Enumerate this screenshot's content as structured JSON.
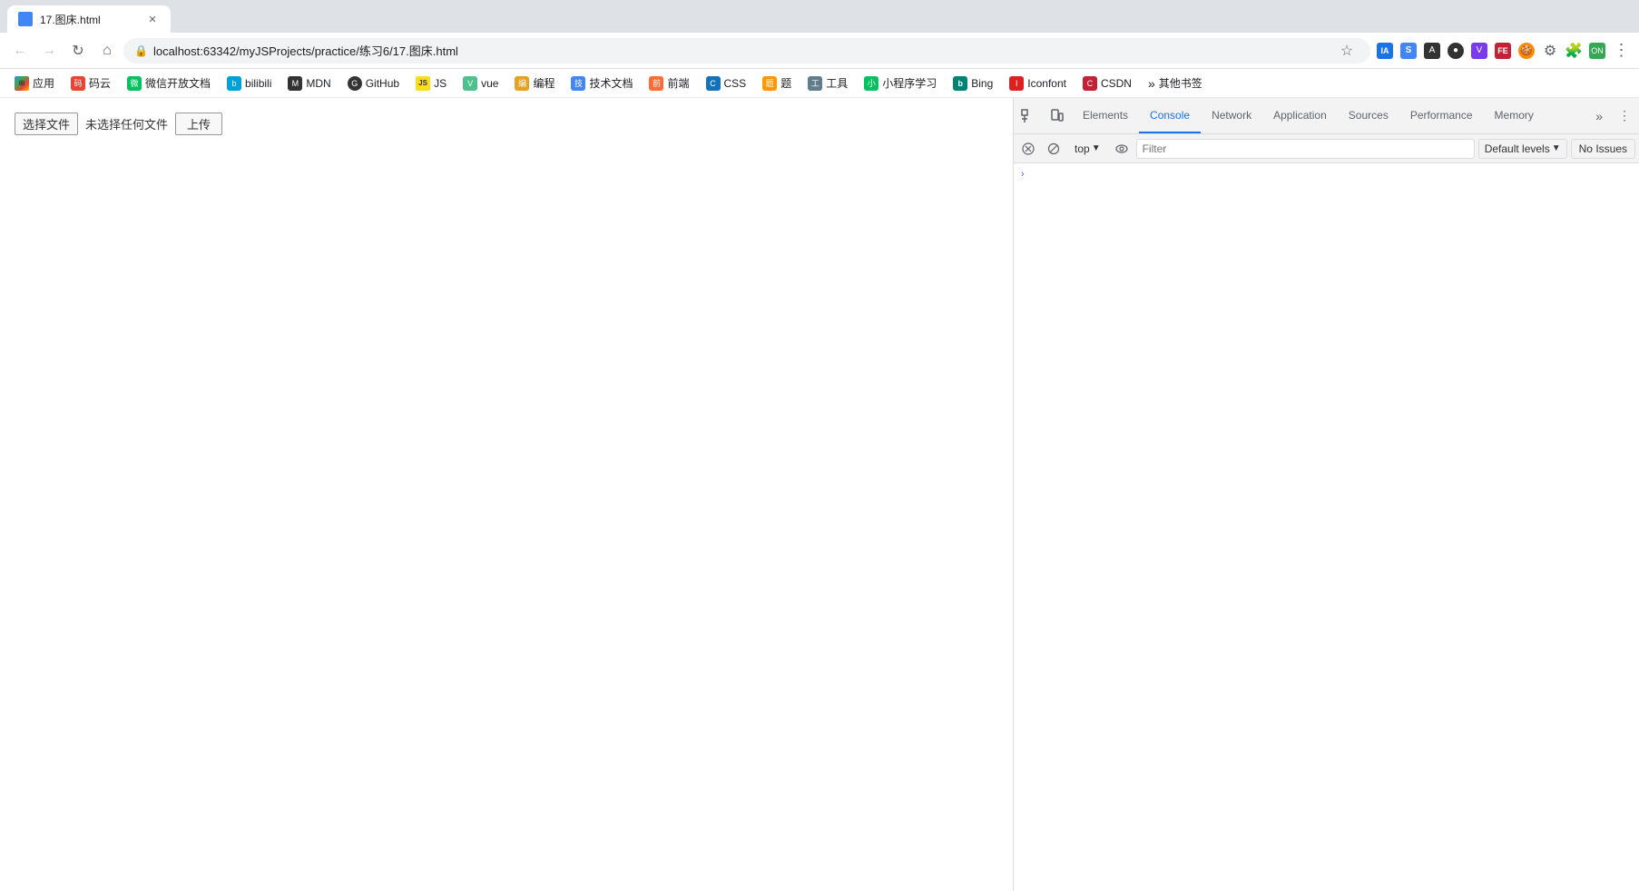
{
  "browser": {
    "tab": {
      "title": "17.图床.html",
      "favicon_color": "#4285f4"
    },
    "address": "localhost:63342/myJSProjects/practice/练习6/17.图床.html",
    "buttons": {
      "back": "‹",
      "forward": "›",
      "reload": "↻",
      "home": "⌂"
    }
  },
  "bookmarks": [
    {
      "label": "应用",
      "icon": "apps",
      "class": "bm-apps"
    },
    {
      "label": "码云",
      "icon": "my",
      "class": "bm-myyun"
    },
    {
      "label": "微信开放文档",
      "icon": "wx",
      "class": "bm-wechat"
    },
    {
      "label": "bilibili",
      "icon": "b",
      "class": "bm-bili"
    },
    {
      "label": "MDN",
      "icon": "M",
      "class": "bm-mdn"
    },
    {
      "label": "GitHub",
      "icon": "G",
      "class": "bm-github"
    },
    {
      "label": "JS",
      "icon": "JS",
      "class": "bm-js"
    },
    {
      "label": "vue",
      "icon": "V",
      "class": "bm-vue"
    },
    {
      "label": "编程",
      "icon": "编",
      "class": "bm-code"
    },
    {
      "label": "技术文档",
      "icon": "技",
      "class": "bm-tech"
    },
    {
      "label": "前端",
      "icon": "前",
      "class": "bm-front"
    },
    {
      "label": "CSS",
      "icon": "C",
      "class": "bm-css"
    },
    {
      "label": "题",
      "icon": "题",
      "class": "bm-ti"
    },
    {
      "label": "工具",
      "icon": "工",
      "class": "bm-tools"
    },
    {
      "label": "小程序学习",
      "icon": "小",
      "class": "bm-mini"
    },
    {
      "label": "Bing",
      "icon": "B",
      "class": "bm-bing"
    },
    {
      "label": "Iconfont",
      "icon": "I",
      "class": "bm-iconfont"
    },
    {
      "label": "CSDN",
      "icon": "C",
      "class": "bm-csdn"
    },
    {
      "label": "其他书签",
      "icon": "☆",
      "class": ""
    }
  ],
  "page": {
    "file_choose_label": "选择文件",
    "no_file_label": "未选择任何文件",
    "upload_label": "上传"
  },
  "devtools": {
    "tabs": [
      {
        "label": "Elements",
        "active": false
      },
      {
        "label": "Console",
        "active": true
      },
      {
        "label": "Network",
        "active": false
      },
      {
        "label": "Application",
        "active": false
      },
      {
        "label": "Sources",
        "active": false
      },
      {
        "label": "Performance",
        "active": false
      },
      {
        "label": "Memory",
        "active": false
      }
    ],
    "console_bar": {
      "top_label": "top",
      "top_arrow": "▼",
      "filter_placeholder": "Filter",
      "default_levels_label": "Default levels",
      "default_levels_arrow": "▼",
      "no_issues_label": "No Issues"
    },
    "console_content": {
      "arrow": "›"
    }
  }
}
